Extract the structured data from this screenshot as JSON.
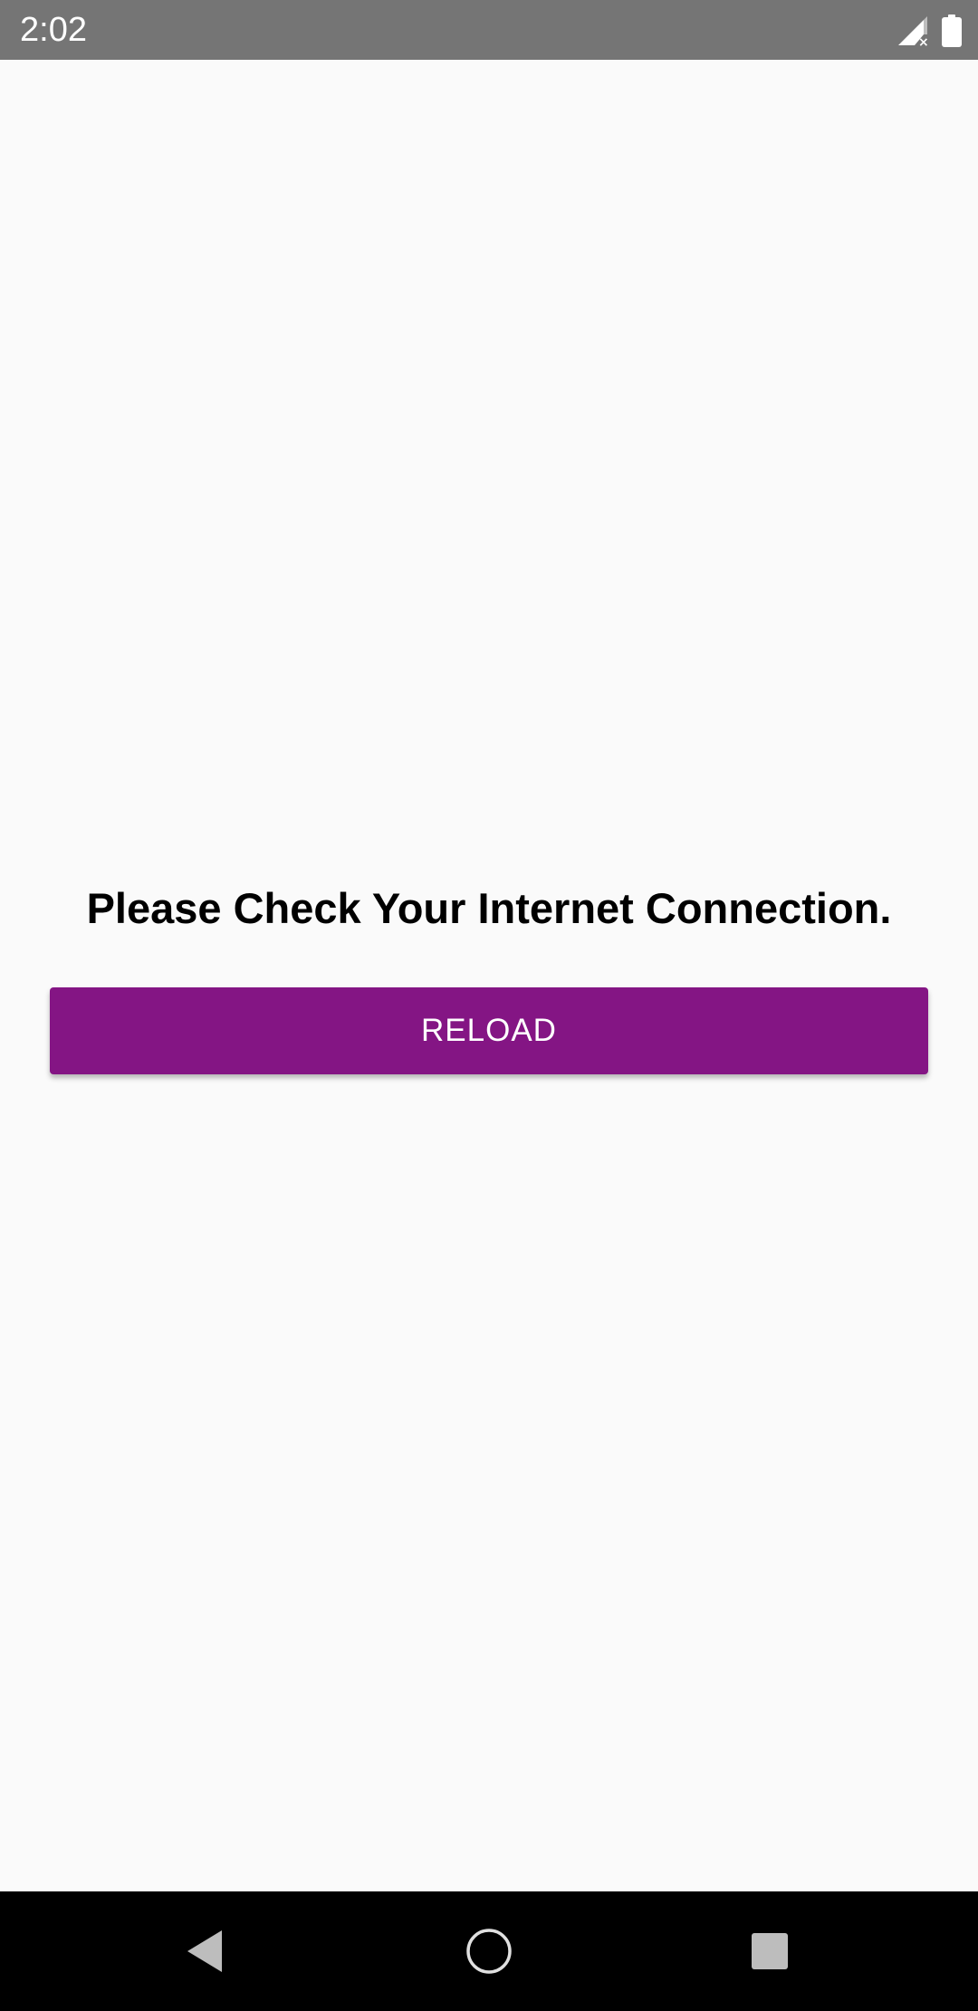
{
  "status_bar": {
    "time": "2:02",
    "icons": [
      "signal-no-data-icon",
      "battery-icon"
    ]
  },
  "main": {
    "message": "Please Check Your Internet Connection.",
    "reload_label": "RELOAD"
  },
  "nav_bar": {
    "buttons": [
      "back-icon",
      "home-icon",
      "recents-icon"
    ]
  },
  "colors": {
    "status_bar": "#757575",
    "background": "#fafafa",
    "button": "#841584",
    "button_text": "#ffffff",
    "nav_bar": "#000000",
    "nav_icons": "#bdbdbd"
  }
}
